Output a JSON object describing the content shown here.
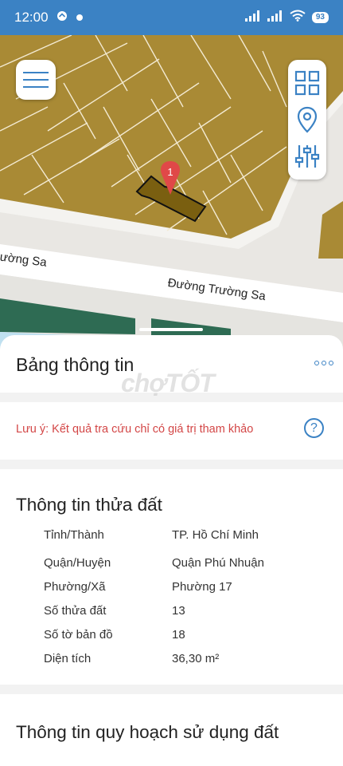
{
  "status_bar": {
    "time": "12:00",
    "battery": "93"
  },
  "map": {
    "street_label_left": "rường Sa",
    "street_label_main": "Đường Trường Sa",
    "parcel_marker": "1"
  },
  "panel": {
    "header_title": "Bảng thông tin",
    "watermark": "chợTỐT",
    "note": "Lưu ý: Kết quả tra cứu chỉ có giá trị tham khảo",
    "help_symbol": "?",
    "land_section_title": "Thông tin thửa đất",
    "land_rows": [
      {
        "label": "Tỉnh/Thành",
        "value": "TP. Hồ Chí Minh"
      },
      {
        "label": "Quận/Huyện",
        "value": "Quận Phú Nhuận"
      },
      {
        "label": "Phường/Xã",
        "value": "Phường 17"
      },
      {
        "label": "Số thửa đất",
        "value": "13"
      },
      {
        "label": "Số tờ bản đồ",
        "value": "18"
      },
      {
        "label": "Diện tích",
        "value": "36,30 m²"
      }
    ],
    "planning_section_title": "Thông tin quy hoạch sử dụng đất"
  },
  "colors": {
    "accent": "#3b82c4",
    "parcel": "#a98a35",
    "highlight_parcel": "#7a5f10",
    "note": "#d34646"
  },
  "icons": [
    "menu-icon",
    "grid-icon",
    "location-pin-icon",
    "sliders-icon",
    "more-icon",
    "help-icon"
  ]
}
